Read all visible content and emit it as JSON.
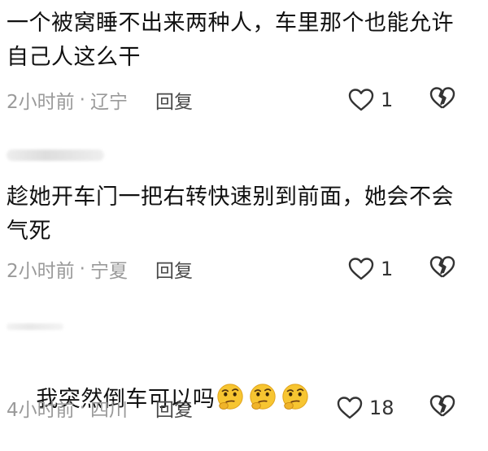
{
  "comments": [
    {
      "text": "一个被窝睡不出来两种人，车里那个也能允许自己人这么干",
      "time": "2小时前",
      "separator": "·",
      "location": "辽宁",
      "reply_label": "回复",
      "likes": "1",
      "emoji_count": 0
    },
    {
      "text": "趁她开车门一把右转快速别到前面，她会不会气死",
      "time": "2小时前",
      "separator": "·",
      "location": "宁夏",
      "reply_label": "回复",
      "likes": "1",
      "emoji_count": 0
    },
    {
      "text": "我突然倒车可以吗",
      "time": "4小时前",
      "separator": "·",
      "location": "四川",
      "reply_label": "回复",
      "likes": "18",
      "emoji_count": 3,
      "emoji_name": "thinking-face-emoji"
    }
  ],
  "icons": {
    "like": "heart-outline-icon",
    "dislike": "broken-heart-icon"
  },
  "colors": {
    "text": "#111111",
    "meta": "#9a9a9a",
    "reply": "#4a4a4a",
    "icon": "#333333",
    "emoji_face": "#f7c531"
  }
}
